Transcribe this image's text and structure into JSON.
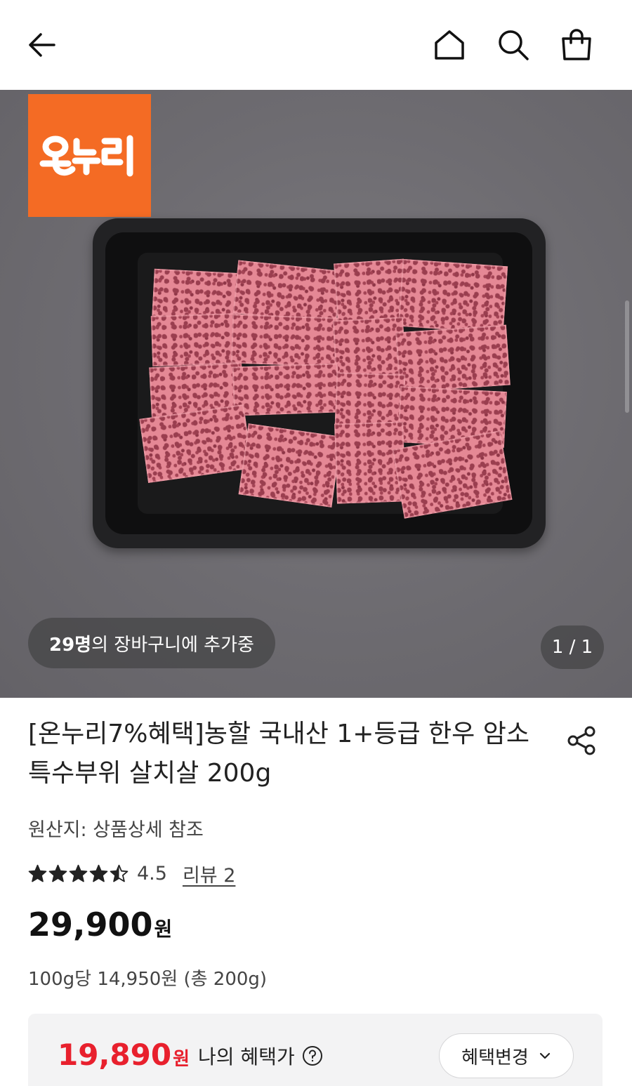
{
  "topbar": {
    "icons": [
      "back-arrow-icon",
      "home-icon",
      "search-icon",
      "cart-bag-icon"
    ]
  },
  "hero": {
    "logo_text": "온누리",
    "cart_count": "29명",
    "cart_text": "의 장바구니에 추가중",
    "pager": "1 / 1"
  },
  "product": {
    "title": "[온누리7%혜택]농할 국내산 1+등급 한우 암소 특수부위 살치살 200g",
    "origin": "원산지: 상품상세 참조",
    "rating": 4.5,
    "rating_text": "4.5",
    "review_link": "리뷰 2",
    "price": "29,900",
    "price_unit": "원",
    "unit_price": "100g당 14,950원 (총 200g)"
  },
  "benefit": {
    "price": "19,890",
    "price_unit": "원",
    "label": "나의 혜택가",
    "change_button": "혜택변경"
  },
  "colors": {
    "accent_red": "#e8202d",
    "logo_orange": "#f46b24",
    "text": "#222222"
  }
}
